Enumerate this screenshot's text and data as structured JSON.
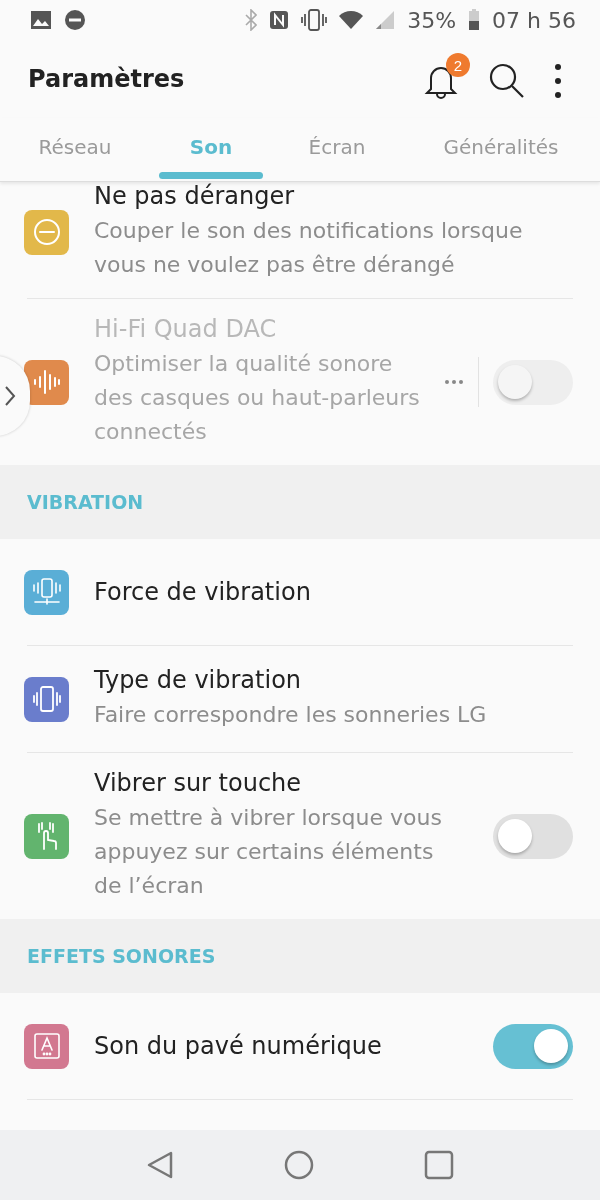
{
  "status_bar": {
    "battery": "35%",
    "time": "07 h 56"
  },
  "app_bar": {
    "title": "Paramètres",
    "notification_count": "2"
  },
  "tabs": [
    {
      "label": "Réseau",
      "selected": false
    },
    {
      "label": "Son",
      "selected": true
    },
    {
      "label": "Écran",
      "selected": false
    },
    {
      "label": "Généralités",
      "selected": false
    }
  ],
  "sections": [
    {
      "items": [
        {
          "kind": "plain",
          "title": "Ne pas déranger",
          "subtitle": "Couper le son des notifications lorsque vous ne voulez pas être dérangé",
          "color": "#e2b84a",
          "disabled": false
        },
        {
          "kind": "menu_switch",
          "title": "Hi-Fi Quad DAC",
          "subtitle": "Optimiser la qualité sonore des casques ou haut-parleurs connectés",
          "color": "#e08a4c",
          "disabled": true,
          "on": false
        }
      ]
    },
    {
      "header": "VIBRATION",
      "items": [
        {
          "kind": "plain",
          "title": "Force de vibration",
          "color": "#5aaed6",
          "disabled": false
        },
        {
          "kind": "plain",
          "title": "Type de vibration",
          "subtitle": "Faire correspondre les sonneries LG",
          "color": "#6a7dcc",
          "disabled": false
        },
        {
          "kind": "switch",
          "title": "Vibrer sur touche",
          "subtitle": "Se mettre à vibrer lorsque vous appuyez sur certains éléments de l’écran",
          "color": "#62b46e",
          "disabled": false,
          "on": false
        }
      ]
    },
    {
      "header": "EFFETS SONORES",
      "items": [
        {
          "kind": "switch",
          "title": "Son du pavé numérique",
          "color": "#d27890",
          "disabled": false,
          "on": true
        }
      ]
    }
  ]
}
